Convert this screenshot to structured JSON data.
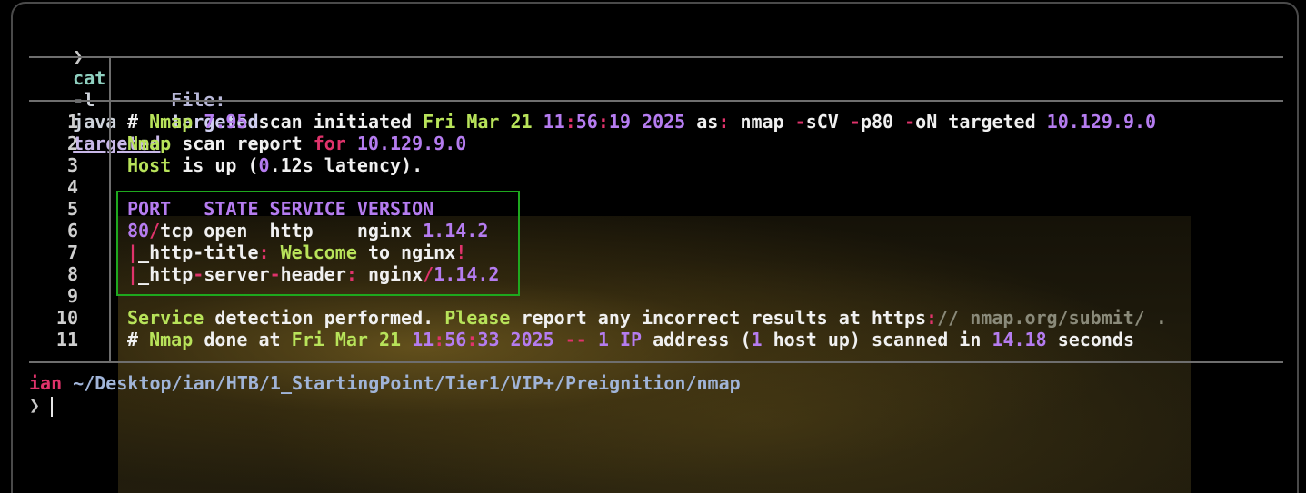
{
  "terminal": {
    "command": {
      "prompt_symbol": "❯",
      "name": "cat",
      "flag": "-l",
      "lang": "java",
      "file": "targeted"
    },
    "header": {
      "label": "File:",
      "filename": "targeted"
    },
    "line_numbers": [
      "1",
      "2",
      "3",
      "4",
      "5",
      "6",
      "7",
      "8",
      "9",
      "10",
      "11"
    ],
    "lines": {
      "l1": {
        "hash": "#",
        "nmap": "Nmap",
        "version": "7.95",
        "scan_initiated": "scan initiated",
        "date": "Fri Mar 21",
        "hh": "11",
        "c1": ":",
        "mm": "56",
        "c2": ":",
        "ss": "19",
        "year": "2025",
        "as": "as",
        "colon": ":",
        "nmap_cmd": "nmap",
        "dash1": "-",
        "sCV": "sCV",
        "dash2": "-",
        "p80": "p80",
        "dash3": "-",
        "oN": "oN",
        "targeted": "targeted",
        "ip": "10.129.9.0"
      },
      "l2": {
        "nmap": "Nmap",
        "scan_report": "scan report",
        "for": "for",
        "ip": "10.129.9.0"
      },
      "l3": {
        "host": "Host",
        "is_up": "is up (",
        "zero": "0",
        "dot": ".",
        "latency": "12s latency)."
      },
      "l5": {
        "header": "PORT   STATE SERVICE VERSION"
      },
      "l6": {
        "port": "80",
        "slash": "/",
        "tcp": "tcp open  http    nginx",
        "ver": "1.14.2"
      },
      "l7": {
        "pipe": "|",
        "name": "_http-title",
        "colon": ":",
        "welcome": "Welcome",
        "to": "to nginx",
        "bang": "!"
      },
      "l8": {
        "pipe": "|",
        "name1": "_http",
        "dash1": "-",
        "name2": "server",
        "dash2": "-",
        "name3": "header",
        "colon": ":",
        "nginx": "nginx",
        "slash": "/",
        "ver": "1.14.2"
      },
      "l10": {
        "service": "Service",
        "detection": "detection performed.",
        "please": "Please",
        "rest": "report any incorrect results at https",
        "colon": ":",
        "slashes": "//",
        "url": "nmap.org/submit/ ."
      },
      "l11": {
        "hash": "#",
        "nmap": "Nmap",
        "done": "done at",
        "date": "Fri Mar 21",
        "hh": "11",
        "c1": ":",
        "mm": "56",
        "c2": ":",
        "ss": "33",
        "year": "2025",
        "dashes": "--",
        "one": "1",
        "ip_label": "IP",
        "address": "address (",
        "one2": "1",
        "host_up": "host up) scanned in",
        "time": "14.18",
        "seconds": "seconds"
      }
    },
    "next_prompt": {
      "user": "ian",
      "path": "~/Desktop/ian/HTB/1_StartingPoint/Tier1/VIP+/Preignition/nmap",
      "prompt_symbol": "❯"
    }
  }
}
